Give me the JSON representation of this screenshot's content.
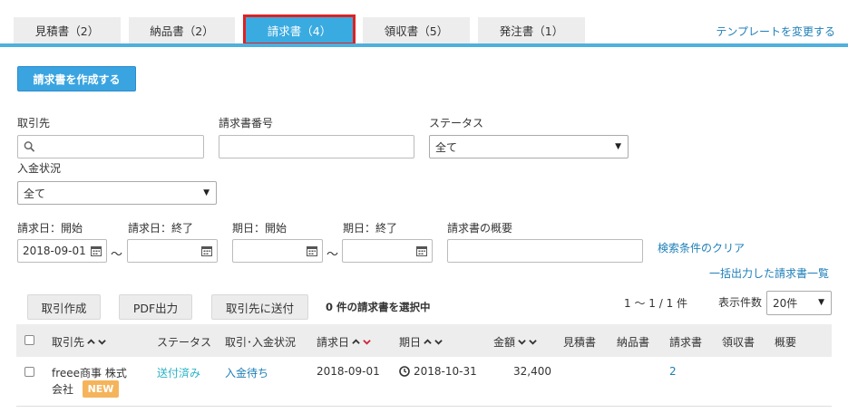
{
  "tabs": [
    {
      "label": "見積書（2）"
    },
    {
      "label": "納品書（2）"
    },
    {
      "label": "請求書（4）"
    },
    {
      "label": "領収書（5）"
    },
    {
      "label": "発注書（1）"
    }
  ],
  "template_link": "テンプレートを変更する",
  "create_button": "請求書を作成する",
  "filters": {
    "partner_label": "取引先",
    "invoice_no_label": "請求書番号",
    "status_label": "ステータス",
    "status_value": "全て",
    "payment_label": "入金状況",
    "payment_value": "全て",
    "invoice_start_label": "請求日：開始",
    "invoice_start_value": "2018-09-01",
    "invoice_end_label": "請求日：終了",
    "due_start_label": "期日：開始",
    "due_end_label": "期日：終了",
    "summary_label": "請求書の概要",
    "range_sep": "〜",
    "clear_link": "検索条件のクリア",
    "bulk_link": "一括出力した請求書一覧"
  },
  "actions": {
    "create_deal": "取引作成",
    "pdf": "PDF出力",
    "send": "取引先に送付",
    "selection": "0 件の請求書を選択中",
    "pager": "1 〜 1 / 1 件",
    "per_page_label": "表示件数",
    "per_page_value": "20件"
  },
  "table": {
    "headers": {
      "partner": "取引先",
      "status": "ステータス",
      "deal_payment": "取引･入金状況",
      "invoice_date": "請求日",
      "due_date": "期日",
      "amount": "金額",
      "estimate": "見積書",
      "delivery": "納品書",
      "invoice": "請求書",
      "receipt": "領収書",
      "summary": "概要"
    },
    "rows": [
      {
        "partner_line1": "freee商事 株式",
        "partner_line2": "会社",
        "badge": "NEW",
        "status": "送付済み",
        "payment": "入金待ち",
        "invoice_date": "2018-09-01",
        "due_date": "2018-10-31",
        "amount": "32,400",
        "invoice_count": "2"
      }
    ]
  },
  "colors": {
    "accent": "#3aabe0",
    "link": "#1d7fb8",
    "badge": "#f5b45b",
    "highlight": "#e02020"
  }
}
